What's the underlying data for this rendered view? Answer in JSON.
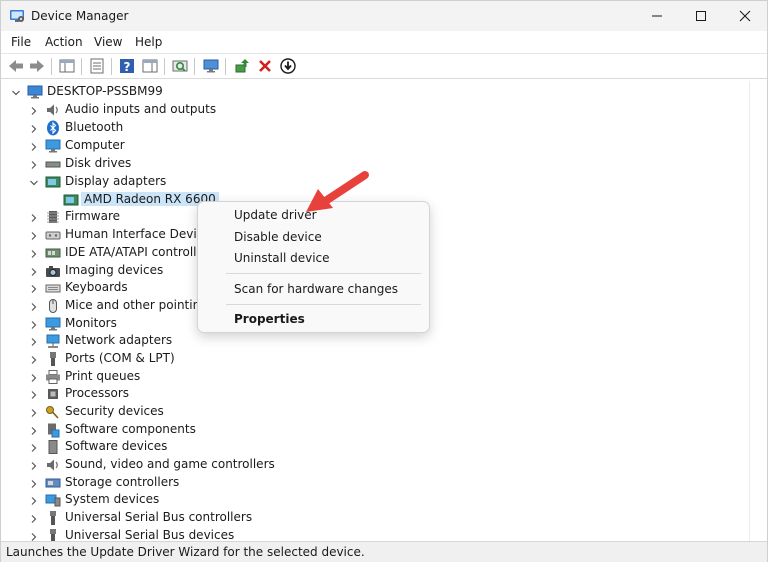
{
  "window": {
    "title": "Device Manager"
  },
  "menu": {
    "items": [
      "File",
      "Action",
      "View",
      "Help"
    ]
  },
  "toolbar": {
    "buttons": [
      "back-icon",
      "forward-icon",
      "properties-pane-icon",
      "show-hide-tree-icon",
      "help-icon",
      "action-pane-icon",
      "scan-hardware-icon",
      "monitor-icon",
      "update-driver-icon",
      "uninstall-device-icon",
      "disable-device-icon"
    ]
  },
  "tree": {
    "root": "DESKTOP-PSSBM99",
    "categories": [
      "Audio inputs and outputs",
      "Bluetooth",
      "Computer",
      "Disk drives",
      "Display adapters",
      "Firmware",
      "Human Interface Devices",
      "IDE ATA/ATAPI controllers",
      "Imaging devices",
      "Keyboards",
      "Mice and other pointing devices",
      "Monitors",
      "Network adapters",
      "Ports (COM & LPT)",
      "Print queues",
      "Processors",
      "Security devices",
      "Software components",
      "Software devices",
      "Sound, video and game controllers",
      "Storage controllers",
      "System devices",
      "Universal Serial Bus controllers",
      "Universal Serial Bus devices"
    ],
    "expanded_category": "Display adapters",
    "selected_device": "AMD Radeon RX 6600"
  },
  "context_menu": {
    "update_driver": "Update driver",
    "disable_device": "Disable device",
    "uninstall_device": "Uninstall device",
    "scan_hardware": "Scan for hardware changes",
    "properties": "Properties"
  },
  "status": {
    "text": "Launches the Update Driver Wizard for the selected device."
  },
  "colors": {
    "selection": "#cce4f7",
    "arrow": "#e8403a",
    "accent": "#0a6cc4"
  }
}
